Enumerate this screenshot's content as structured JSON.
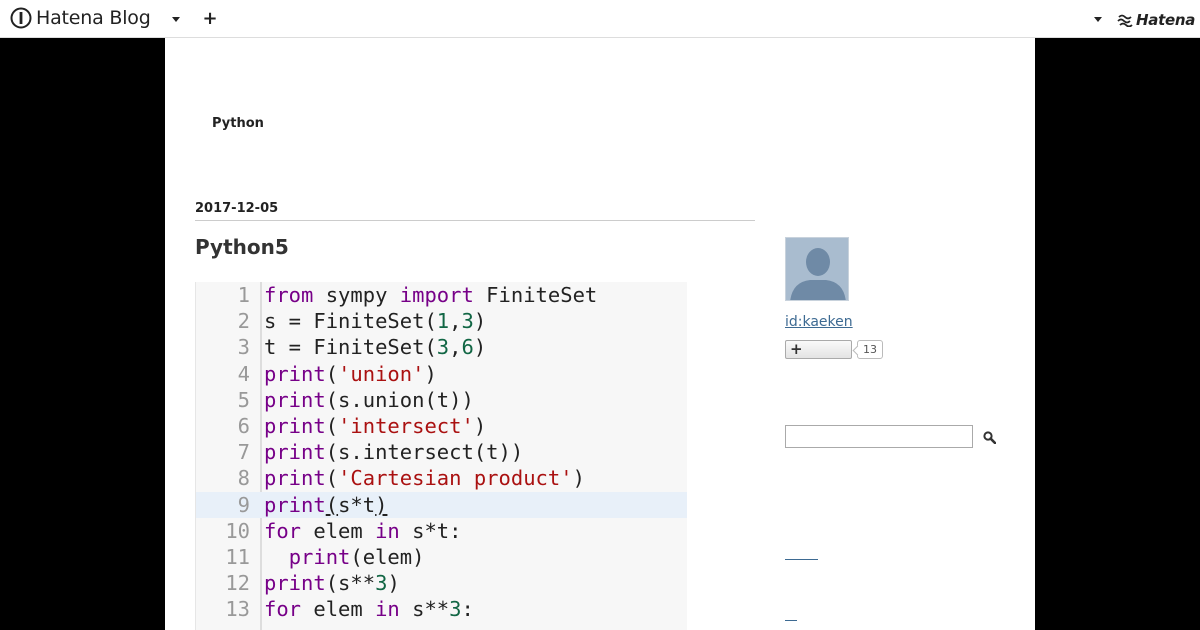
{
  "header": {
    "logo_text": "Hatena Blog",
    "plus_label": "+",
    "brand_text": "Hatena"
  },
  "blog": {
    "title": "Python"
  },
  "entry": {
    "date": "2017-12-05",
    "title": "Python5"
  },
  "code": {
    "lines": [
      {
        "n": "1"
      },
      {
        "n": "2"
      },
      {
        "n": "3"
      },
      {
        "n": "4"
      },
      {
        "n": "5"
      },
      {
        "n": "6"
      },
      {
        "n": "7"
      },
      {
        "n": "8"
      },
      {
        "n": "9"
      },
      {
        "n": "10"
      },
      {
        "n": "11"
      },
      {
        "n": "12"
      },
      {
        "n": "13"
      }
    ],
    "tokens": {
      "l1": [
        "from",
        " sympy ",
        "import",
        " FiniteSet"
      ],
      "l2": [
        "s = FiniteSet(",
        "1",
        ",",
        "3",
        ")"
      ],
      "l3": [
        "t = FiniteSet(",
        "3",
        ",",
        "6",
        ")"
      ],
      "l4": [
        "print",
        "(",
        "'union'",
        ")"
      ],
      "l5": [
        "print",
        "(s.union(t))"
      ],
      "l6": [
        "print",
        "(",
        "'intersect'",
        ")"
      ],
      "l7": [
        "print",
        "(s.intersect(t))"
      ],
      "l8": [
        "print",
        "(",
        "'Cartesian product'",
        ")"
      ],
      "l9": [
        "print",
        "(",
        "s*t",
        ")"
      ],
      "l10": [
        "for",
        " elem ",
        "in",
        " s*t:"
      ],
      "l11": [
        "  ",
        "print",
        "(elem)"
      ],
      "l12": [
        "print",
        "(s**",
        "3",
        ")"
      ],
      "l13": [
        "for",
        " elem ",
        "in",
        " s**",
        "3",
        ":"
      ]
    },
    "colors": {
      "keyword": "#770088",
      "string": "#aa1111",
      "number": "#116644"
    }
  },
  "sidebar": {
    "profile_id": "id:kaeken",
    "subscribe_plus": "+",
    "subscriber_count": "13",
    "search_placeholder": ""
  }
}
